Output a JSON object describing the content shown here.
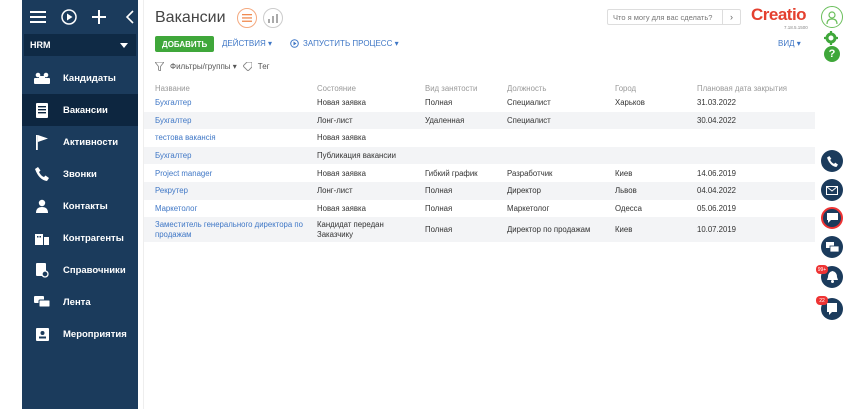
{
  "sidebar": {
    "group": "HRM",
    "items": [
      {
        "label": "Кандидаты",
        "icon": "candidates-icon"
      },
      {
        "label": "Вакансии",
        "icon": "vacancies-icon",
        "active": true
      },
      {
        "label": "Активности",
        "icon": "flag-icon"
      },
      {
        "label": "Звонки",
        "icon": "phone-icon"
      },
      {
        "label": "Контакты",
        "icon": "person-icon"
      },
      {
        "label": "Контрагенты",
        "icon": "building-icon"
      },
      {
        "label": "Справочники",
        "icon": "lookup-icon"
      },
      {
        "label": "Лента",
        "icon": "feed-icon"
      },
      {
        "label": "Мероприятия",
        "icon": "event-icon"
      }
    ]
  },
  "header": {
    "title": "Вакансии",
    "search_placeholder": "Что я могу для вас сделать?",
    "logo": "Creatio",
    "logo_version": "7.18.5.1500"
  },
  "toolbar": {
    "add_label": "ДОБАВИТЬ",
    "actions_label": "ДЕЙСТВИЯ ▾",
    "run_process_label": "ЗАПУСТИТЬ ПРОЦЕСС ▾",
    "view_label": "ВИД ▾"
  },
  "filters": {
    "filter_label": "Фильтры/группы ▾",
    "tag_label": "Тег"
  },
  "table": {
    "columns": [
      "Название",
      "Состояние",
      "Вид занятости",
      "Должность",
      "Город",
      "Плановая дата закрытия"
    ],
    "rows": [
      [
        "Бухгалтер",
        "Новая заявка",
        "Полная",
        "Специалист",
        "Харьков",
        "31.03.2022"
      ],
      [
        "Бухгалтер",
        "Лонг-лист",
        "Удаленная",
        "Специалист",
        "",
        "30.04.2022"
      ],
      [
        "тестова вакансія",
        "Новая заявка",
        "",
        "",
        "",
        ""
      ],
      [
        "Бухгалтер",
        "Публикация вакансии",
        "",
        "",
        "",
        ""
      ],
      [
        "Project manager",
        "Новая заявка",
        "Гибкий график",
        "Разработчик",
        "Киев",
        "14.06.2019"
      ],
      [
        "Рекрутер",
        "Лонг-лист",
        "Полная",
        "Директор",
        "Львов",
        "04.04.2022"
      ],
      [
        "Маркетолог",
        "Новая заявка",
        "Полная",
        "Маркетолог",
        "Одесса",
        "05.06.2019"
      ],
      [
        "Заместитель генерального директора по продажам",
        "Кандидат передан Заказчику",
        "Полная",
        "Директор по продажам",
        "Киев",
        "10.07.2019"
      ]
    ]
  },
  "rightbar": {
    "badge_notifications": "99+",
    "badge_feed": "22"
  },
  "colors": {
    "sidebar": "#1b3b5c",
    "accent_green": "#3fa73a",
    "link_blue": "#3f77c6",
    "logo_red": "#e4402f"
  }
}
